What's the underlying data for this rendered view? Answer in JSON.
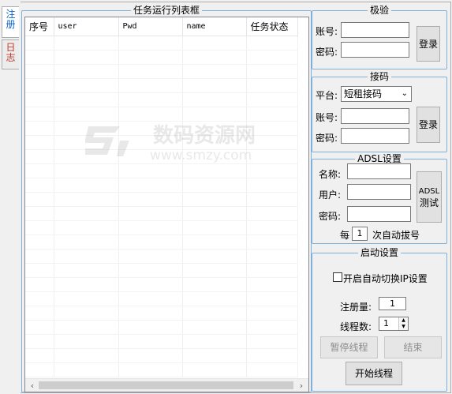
{
  "tabs": [
    {
      "label": "注册",
      "active": true
    },
    {
      "label": "日志",
      "active": false
    }
  ],
  "task_list": {
    "title": "任务运行列表框",
    "columns": [
      "序号",
      "user",
      "Pwd",
      "name",
      "任务状态"
    ],
    "rows": []
  },
  "verify": {
    "title": "极验",
    "account_label": "账号:",
    "account_value": "",
    "password_label": "密码:",
    "password_value": "",
    "login_button": "登录"
  },
  "code_receive": {
    "title": "接码",
    "platform_label": "平台:",
    "platform_value": "短租接码",
    "account_label": "账号:",
    "account_value": "",
    "password_label": "密码:",
    "password_value": "",
    "login_button": "登录"
  },
  "adsl": {
    "title": "ADSL设置",
    "name_label": "名称:",
    "name_value": "",
    "user_label": "用户:",
    "user_value": "",
    "password_label": "密码:",
    "password_value": "",
    "test_button_line1": "ADSL",
    "test_button_line2": "测试",
    "every_label": "每",
    "every_value": "1",
    "redial_label": "次自动拔号"
  },
  "startup": {
    "title": "启动设置",
    "auto_switch_ip_label": "开启自动切换IP设置",
    "auto_switch_ip_checked": false,
    "register_count_label": "注册量:",
    "register_count_value": "1",
    "thread_count_label": "线程数:",
    "thread_count_value": "1",
    "pause_button": "暂停线程",
    "end_button": "结束",
    "start_button": "开始线程"
  },
  "watermark": {
    "text_cn": "数码资源网",
    "text_url": "www.smzy.com"
  }
}
